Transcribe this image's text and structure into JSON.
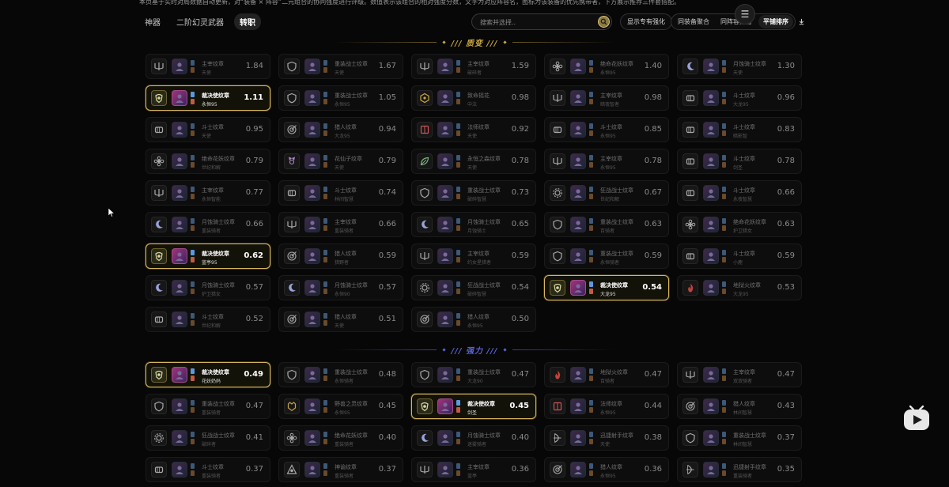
{
  "notice": "本页基于实时对局数据自动更新，对“装备 × 阵容”二元组合的协同强度进行评级。数值表示该组合的相对强度分数，文字为对应阵容名，图标为该装备的优先携带者，下方展示推荐三件套搭配。",
  "tabs": [
    {
      "label": "神器",
      "active": false
    },
    {
      "label": "二阶幻灵武器",
      "active": false
    },
    {
      "label": "转职",
      "active": true
    }
  ],
  "search": {
    "placeholder": "搜索并选择..",
    "icon": "search-icon"
  },
  "controls": {
    "exclusive_label": "显示专有强化",
    "sort_options": [
      {
        "label": "同装备聚合",
        "selected": false
      },
      {
        "label": "同阵容聚合",
        "selected": false
      },
      {
        "label": "平铺排序",
        "selected": true
      }
    ],
    "menu_icon": "menu-icon",
    "download_icon": "download-icon"
  },
  "colors": {
    "highlight_border": "#d9b65a",
    "section1": "#c9a640",
    "section2": "#5a63d8"
  },
  "sections": [
    {
      "title": "质变",
      "cards": [
        {
          "name": "主宰纹章",
          "sub": "天使",
          "value": "1.84",
          "icon": "trident-icon",
          "hl": false
        },
        {
          "name": "重装战士纹章",
          "sub": "天使",
          "value": "1.67",
          "icon": "shield-icon",
          "hl": false
        },
        {
          "name": "主宰纹章",
          "sub": "破碎者",
          "value": "1.59",
          "icon": "trident-icon",
          "hl": false
        },
        {
          "name": "绝命花妖纹章",
          "sub": "永恒95",
          "value": "1.40",
          "icon": "flower-icon",
          "hl": false
        },
        {
          "name": "月蚀骑士纹章",
          "sub": "天使",
          "value": "1.30",
          "icon": "moon-icon",
          "hl": false
        },
        {
          "name": "裁决使纹章",
          "sub": "永恒95",
          "value": "1.11",
          "icon": "crest-icon",
          "hl": true
        },
        {
          "name": "重装战士纹章",
          "sub": "永恒95",
          "value": "1.05",
          "icon": "shield-icon",
          "hl": false
        },
        {
          "name": "致命摇花",
          "sub": "中法",
          "value": "0.98",
          "icon": "hex-icon",
          "hl": false
        },
        {
          "name": "主宰纹章",
          "sub": "暗夜智者",
          "value": "0.98",
          "icon": "trident-icon",
          "hl": false
        },
        {
          "name": "斗士纹章",
          "sub": "大龙95",
          "value": "0.96",
          "icon": "fist-icon",
          "hl": false
        },
        {
          "name": "斗士纹章",
          "sub": "天使",
          "value": "0.95",
          "icon": "fist-icon",
          "hl": false
        },
        {
          "name": "猎人纹章",
          "sub": "大龙95",
          "value": "0.94",
          "icon": "target-icon",
          "hl": false
        },
        {
          "name": "法师纹章",
          "sub": "天使",
          "value": "0.92",
          "icon": "book-icon",
          "hl": false
        },
        {
          "name": "斗士纹章",
          "sub": "永恒95",
          "value": "0.85",
          "icon": "fist-icon",
          "hl": false
        },
        {
          "name": "斗士纹章",
          "sub": "暗影智",
          "value": "0.83",
          "icon": "fist-icon",
          "hl": false
        },
        {
          "name": "绝命花妖纹章",
          "sub": "世纪和解",
          "value": "0.79",
          "icon": "flower-icon",
          "hl": false
        },
        {
          "name": "花仙子纹章",
          "sub": "天使",
          "value": "0.79",
          "icon": "fairy-icon",
          "hl": false
        },
        {
          "name": "永恒之森纹章",
          "sub": "天使",
          "value": "0.78",
          "icon": "leaf-icon",
          "hl": false
        },
        {
          "name": "主宰纹章",
          "sub": "永恒95",
          "value": "0.78",
          "icon": "trident-icon",
          "hl": false
        },
        {
          "name": "斗士纹章",
          "sub": "剑圣",
          "value": "0.78",
          "icon": "fist-icon",
          "hl": false
        },
        {
          "name": "主宰纹章",
          "sub": "永恒智能",
          "value": "0.77",
          "icon": "trident-icon",
          "hl": false
        },
        {
          "name": "斗士纹章",
          "sub": "林间智慧",
          "value": "0.74",
          "icon": "fist-icon",
          "hl": false
        },
        {
          "name": "重装战士纹章",
          "sub": "破碎智慧",
          "value": "0.73",
          "icon": "shield-icon",
          "hl": false
        },
        {
          "name": "狂战战士纹章",
          "sub": "世纪和解",
          "value": "0.67",
          "icon": "gear-icon",
          "hl": false
        },
        {
          "name": "斗士纹章",
          "sub": "永夜智慧",
          "value": "0.66",
          "icon": "fist-icon",
          "hl": false
        },
        {
          "name": "月蚀骑士纹章",
          "sub": "重装骑者",
          "value": "0.66",
          "icon": "moon-icon",
          "hl": false
        },
        {
          "name": "主宰纹章",
          "sub": "重装骑者",
          "value": "0.66",
          "icon": "trident-icon",
          "hl": false
        },
        {
          "name": "月蚀骑士纹章",
          "sub": "月蚀骑士",
          "value": "0.65",
          "icon": "moon-icon",
          "hl": false
        },
        {
          "name": "重装战士纹章",
          "sub": "百骑者",
          "value": "0.63",
          "icon": "shield-icon",
          "hl": false
        },
        {
          "name": "绝命花妖纹章",
          "sub": "护卫猎女",
          "value": "0.63",
          "icon": "flower-icon",
          "hl": false
        },
        {
          "name": "裁决使纹章",
          "sub": "蓝亭95",
          "value": "0.62",
          "icon": "crest-icon",
          "hl": true
        },
        {
          "name": "猎人纹章",
          "sub": "猎野者",
          "value": "0.59",
          "icon": "target-icon",
          "hl": false
        },
        {
          "name": "主宰纹章",
          "sub": "约女星猎者",
          "value": "0.59",
          "icon": "trident-icon",
          "hl": false
        },
        {
          "name": "重装战士纹章",
          "sub": "永恒骑者",
          "value": "0.59",
          "icon": "shield-icon",
          "hl": false
        },
        {
          "name": "斗士纹章",
          "sub": "小鹿",
          "value": "0.59",
          "icon": "fist-icon",
          "hl": false
        },
        {
          "name": "月蚀骑士纹章",
          "sub": "护卫猎女",
          "value": "0.57",
          "icon": "moon-icon",
          "hl": false
        },
        {
          "name": "月蚀骑士纹章",
          "sub": "永恒90",
          "value": "0.57",
          "icon": "moon-icon",
          "hl": false
        },
        {
          "name": "狂战战士纹章",
          "sub": "破碎智慧",
          "value": "0.54",
          "icon": "gear-icon",
          "hl": false
        },
        {
          "name": "裁决使纹章",
          "sub": "大龙95",
          "value": "0.54",
          "icon": "crest-icon",
          "hl": true
        },
        {
          "name": "地狱火纹章",
          "sub": "大龙95",
          "value": "0.53",
          "icon": "flame-icon",
          "hl": false
        },
        {
          "name": "斗士纹章",
          "sub": "世纪和解",
          "value": "0.52",
          "icon": "fist-icon",
          "hl": false
        },
        {
          "name": "猎人纹章",
          "sub": "天使",
          "value": "0.51",
          "icon": "target-icon",
          "hl": false
        },
        {
          "name": "猎人纹章",
          "sub": "永恒95",
          "value": "0.50",
          "icon": "target-icon",
          "hl": false
        }
      ]
    },
    {
      "title": "强力",
      "cards": [
        {
          "name": "裁决使纹章",
          "sub": "花妖奶妈",
          "value": "0.49",
          "icon": "crest-icon",
          "hl": true
        },
        {
          "name": "重装战士纹章",
          "sub": "永恒骑者",
          "value": "0.48",
          "icon": "shield-icon",
          "hl": false
        },
        {
          "name": "重装战士纹章",
          "sub": "大龙90",
          "value": "0.47",
          "icon": "shield-icon",
          "hl": false
        },
        {
          "name": "地狱火纹章",
          "sub": "百骑者",
          "value": "0.47",
          "icon": "flame-icon",
          "hl": false
        },
        {
          "name": "主宰纹章",
          "sub": "双双骑者",
          "value": "0.47",
          "icon": "trident-icon",
          "hl": false
        },
        {
          "name": "重装战士纹章",
          "sub": "重装骑者",
          "value": "0.47",
          "icon": "shield-icon",
          "hl": false
        },
        {
          "name": "野兽之灵纹章",
          "sub": "永恒95",
          "value": "0.45",
          "icon": "beast-icon",
          "hl": false
        },
        {
          "name": "裁决使纹章",
          "sub": "剑圣",
          "value": "0.45",
          "icon": "crest-icon",
          "hl": true
        },
        {
          "name": "法师纹章",
          "sub": "永恒95",
          "value": "0.44",
          "icon": "book-icon",
          "hl": false
        },
        {
          "name": "猎人纹章",
          "sub": "林间智慧",
          "value": "0.43",
          "icon": "target-icon",
          "hl": false
        },
        {
          "name": "狂战战士纹章",
          "sub": "破碎者",
          "value": "0.41",
          "icon": "gear-icon",
          "hl": false
        },
        {
          "name": "绝命花妖纹章",
          "sub": "重装骑者",
          "value": "0.40",
          "icon": "flower-icon",
          "hl": false
        },
        {
          "name": "月蚀骑士纹章",
          "sub": "迷雾骑者",
          "value": "0.40",
          "icon": "moon-icon",
          "hl": false
        },
        {
          "name": "迅捷射手纹章",
          "sub": "天使",
          "value": "0.38",
          "icon": "bow-icon",
          "hl": false
        },
        {
          "name": "重装战士纹章",
          "sub": "林间智慧",
          "value": "0.37",
          "icon": "shield-icon",
          "hl": false
        },
        {
          "name": "斗士纹章",
          "sub": "重装骑者",
          "value": "0.37",
          "icon": "fist-icon",
          "hl": false
        },
        {
          "name": "神谕纹章",
          "sub": "重装骑者",
          "value": "0.37",
          "icon": "oracle-icon",
          "hl": false
        },
        {
          "name": "主宰纹章",
          "sub": "蓝亭",
          "value": "0.36",
          "icon": "trident-icon",
          "hl": false
        },
        {
          "name": "猎人纹章",
          "sub": "永恒95",
          "value": "0.36",
          "icon": "target-icon",
          "hl": false
        },
        {
          "name": "迅捷射手纹章",
          "sub": "重装骑者",
          "value": "0.35",
          "icon": "bow-icon",
          "hl": false
        }
      ]
    }
  ]
}
